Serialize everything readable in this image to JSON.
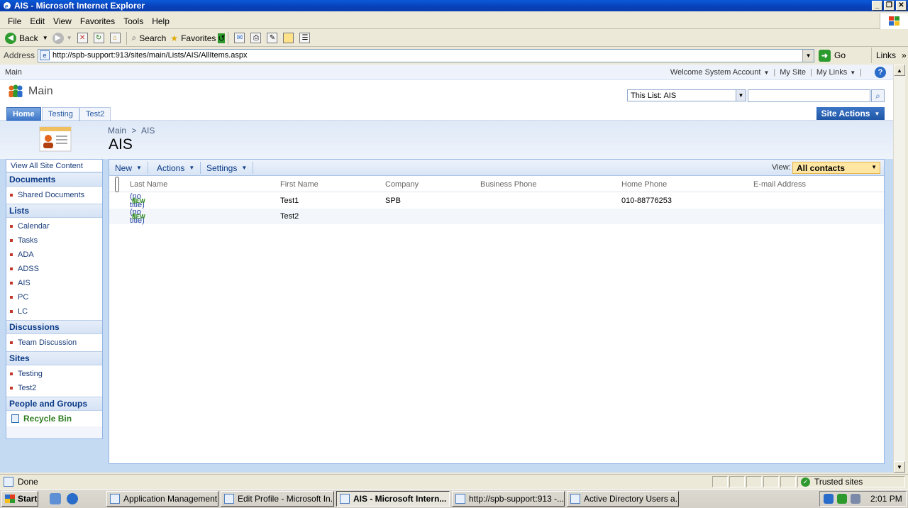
{
  "window": {
    "title": "AIS - Microsoft Internet Explorer",
    "min_glyph": "_",
    "max_glyph": "❐",
    "close_glyph": "✕"
  },
  "menu": [
    "File",
    "Edit",
    "View",
    "Favorites",
    "Tools",
    "Help"
  ],
  "toolbar": {
    "back_label": "Back",
    "search_label": "Search",
    "favorites_label": "Favorites"
  },
  "address": {
    "label": "Address",
    "url": "http://spb-support:913/sites/main/Lists/AIS/AllItems.aspx",
    "go_label": "Go",
    "links_label": "Links",
    "links_more": "»"
  },
  "sharepoint": {
    "top_crumb": "Main",
    "welcome": "Welcome System Account",
    "my_site": "My Site",
    "my_links": "My Links",
    "help_glyph": "?",
    "site_title": "Main",
    "search_scope": "This List: AIS",
    "search_placeholder": "",
    "tabs": [
      "Home",
      "Testing",
      "Test2"
    ],
    "site_actions": "Site Actions",
    "breadcrumb_root": "Main",
    "breadcrumb_sep": ">",
    "breadcrumb_current": "AIS",
    "page_title": "AIS"
  },
  "quicklaunch": {
    "view_all": "View All Site Content",
    "documents_heading": "Documents",
    "documents": [
      "Shared Documents"
    ],
    "lists_heading": "Lists",
    "lists": [
      "Calendar",
      "Tasks",
      "ADA",
      "ADSS",
      "AIS",
      "PC",
      "LC"
    ],
    "discussions_heading": "Discussions",
    "discussions": [
      "Team Discussion"
    ],
    "sites_heading": "Sites",
    "sites": [
      "Testing",
      "Test2"
    ],
    "people_heading": "People and Groups",
    "recycle_bin": "Recycle Bin"
  },
  "list": {
    "toolbar": {
      "new": "New",
      "actions": "Actions",
      "settings": "Settings",
      "view_label": "View:",
      "view_value": "All contacts"
    },
    "columns": [
      "Last Name",
      "First Name",
      "Company",
      "Business Phone",
      "Home Phone",
      "E-mail Address"
    ],
    "rows": [
      {
        "last_name": "(no title)",
        "new_flag": "NEW",
        "first_name": "Test1",
        "company": "SPB",
        "business_phone": "",
        "home_phone": "010-88776253",
        "email": ""
      },
      {
        "last_name": "(no title)",
        "new_flag": "NEW",
        "first_name": "Test2",
        "company": "",
        "business_phone": "",
        "home_phone": "",
        "email": ""
      }
    ]
  },
  "status": {
    "text": "Done",
    "zone": "Trusted sites"
  },
  "taskbar": {
    "start": "Start",
    "tasks": [
      "Application Management ...",
      "Edit Profile - Microsoft In...",
      "AIS - Microsoft Intern...",
      "http://spb-support:913 -...",
      "Active Directory Users a..."
    ],
    "clock": "2:01 PM"
  }
}
